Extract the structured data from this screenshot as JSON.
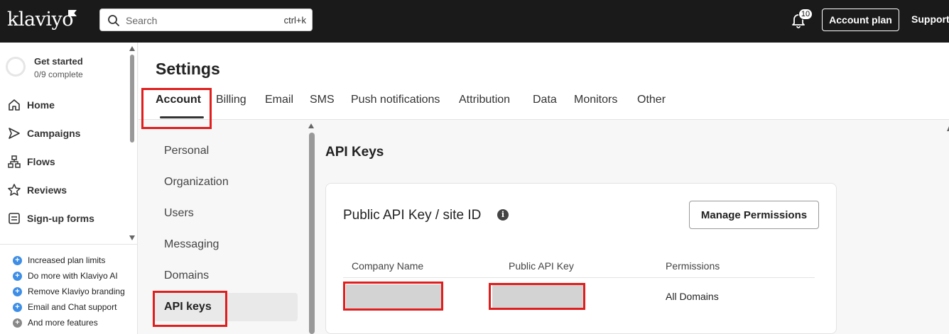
{
  "topbar": {
    "logo": "klaviyo",
    "search_placeholder": "Search",
    "search_shortcut": "ctrl+k",
    "notifications_count": "10",
    "account_plan_label": "Account plan",
    "support_label": "Support"
  },
  "sidebar": {
    "get_started": {
      "title": "Get started",
      "progress": "0/9 complete"
    },
    "items": [
      {
        "label": "Home",
        "icon": "home-icon"
      },
      {
        "label": "Campaigns",
        "icon": "send-icon"
      },
      {
        "label": "Flows",
        "icon": "flows-icon"
      },
      {
        "label": "Reviews",
        "icon": "star-icon"
      },
      {
        "label": "Sign-up forms",
        "icon": "form-icon"
      }
    ],
    "features": [
      "Increased plan limits",
      "Do more with Klaviyo AI",
      "Remove Klaviyo branding",
      "Email and Chat support",
      "And more features"
    ]
  },
  "settings": {
    "title": "Settings",
    "tabs": [
      "Account",
      "Billing",
      "Email",
      "SMS",
      "Push notifications",
      "Attribution",
      "Data",
      "Monitors",
      "Other"
    ],
    "active_tab": "Account",
    "subnav": [
      "Personal",
      "Organization",
      "Users",
      "Messaging",
      "Domains",
      "API keys"
    ],
    "active_subnav": "API keys"
  },
  "api_keys": {
    "section_title": "API Keys",
    "card_title": "Public API Key / site ID",
    "manage_label": "Manage Permissions",
    "columns": [
      "Company Name",
      "Public API Key",
      "Permissions"
    ],
    "row": {
      "permissions": "All Domains"
    }
  },
  "colors": {
    "topbar_bg": "#1a1a1a",
    "highlight_red": "#e01e1e",
    "feature_blue": "#3d8ee6"
  }
}
